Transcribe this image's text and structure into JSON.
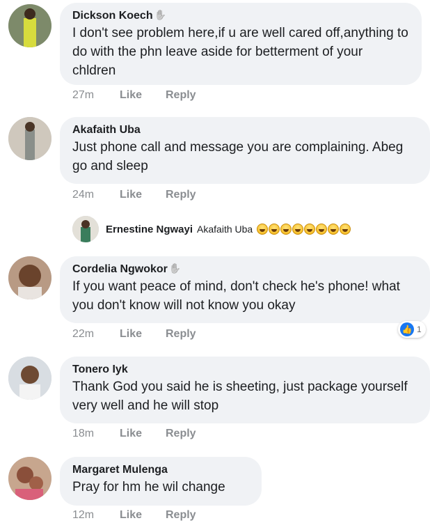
{
  "colors": {
    "bubble": "#f0f2f5",
    "meta": "#8a8d91",
    "like_blue": "#1877f2"
  },
  "comments": [
    {
      "author": "Dickson Koech",
      "text": "I don't see problem here,if u are well cared off,anything to do with the phn leave aside for betterment of your chldren",
      "time": "27m",
      "like": "Like",
      "reply": "Reply"
    },
    {
      "author": "Akafaith Uba",
      "text": "Just phone call and message you are complaining. Abeg go and sleep",
      "time": "24m",
      "like": "Like",
      "reply": "Reply"
    },
    {
      "author": "Cordelia Ngwokor",
      "text": "If you want peace of mind, don't check he's phone! what you don't know will not know you okay",
      "time": "22m",
      "like": "Like",
      "reply": "Reply",
      "reactions": {
        "icon": "like-icon",
        "count": "1"
      }
    },
    {
      "author": "Tonero Iyk",
      "text": "Thank God you said he is sheeting, just package yourself very well and he will stop",
      "time": "18m",
      "like": "Like",
      "reply": "Reply"
    },
    {
      "author": "Margaret Mulenga",
      "text": "Pray for hm he wil change",
      "time": "12m",
      "like": "Like",
      "reply": "Reply"
    }
  ],
  "reply": {
    "author": "Ernestine Ngwayi",
    "mention": "Akafaith Uba",
    "emoji": "laughing-emoji",
    "emoji_count": 8
  }
}
